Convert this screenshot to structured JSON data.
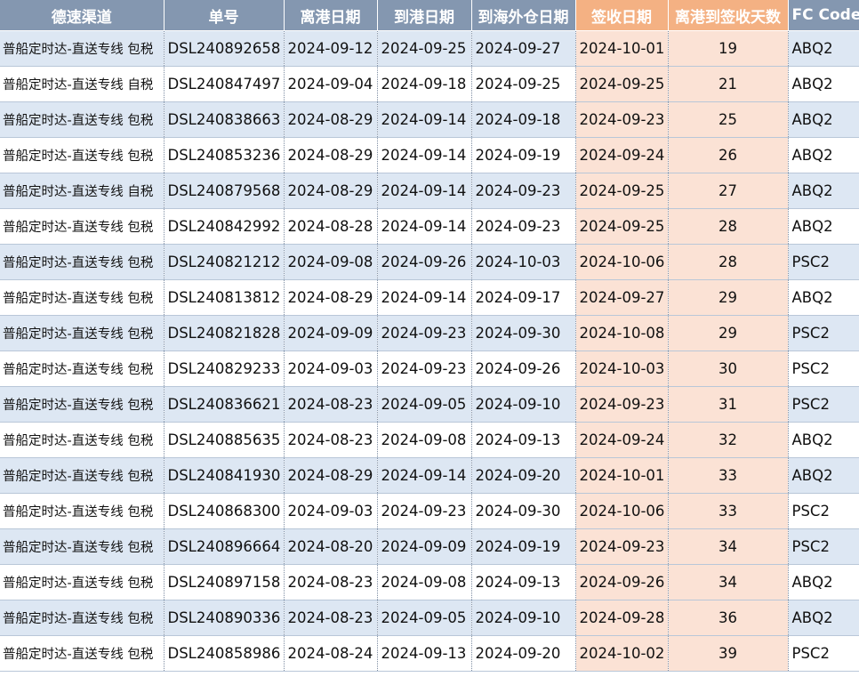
{
  "headers": [
    "德速渠道",
    "单号",
    "离港日期",
    "到港日期",
    "到海外仓日期",
    "签收日期",
    "离港到签收天数",
    "FC Code"
  ],
  "rows": [
    {
      "channel": "普船定时达-直送专线 包税",
      "order": "DSL240892658",
      "depart": "2024-09-12",
      "arrive": "2024-09-25",
      "warehouse": "2024-09-27",
      "signed": "2024-10-01",
      "days": "19",
      "fc": "ABQ2"
    },
    {
      "channel": "普船定时达-直送专线 自税",
      "order": "DSL240847497",
      "depart": "2024-09-04",
      "arrive": "2024-09-18",
      "warehouse": "2024-09-25",
      "signed": "2024-09-25",
      "days": "21",
      "fc": "ABQ2"
    },
    {
      "channel": "普船定时达-直送专线 包税",
      "order": "DSL240838663",
      "depart": "2024-08-29",
      "arrive": "2024-09-14",
      "warehouse": "2024-09-18",
      "signed": "2024-09-23",
      "days": "25",
      "fc": "ABQ2"
    },
    {
      "channel": "普船定时达-直送专线 包税",
      "order": "DSL240853236",
      "depart": "2024-08-29",
      "arrive": "2024-09-14",
      "warehouse": "2024-09-19",
      "signed": "2024-09-24",
      "days": "26",
      "fc": "ABQ2"
    },
    {
      "channel": "普船定时达-直送专线 自税",
      "order": "DSL240879568",
      "depart": "2024-08-29",
      "arrive": "2024-09-14",
      "warehouse": "2024-09-23",
      "signed": "2024-09-25",
      "days": "27",
      "fc": "ABQ2"
    },
    {
      "channel": "普船定时达-直送专线 包税",
      "order": "DSL240842992",
      "depart": "2024-08-28",
      "arrive": "2024-09-14",
      "warehouse": "2024-09-23",
      "signed": "2024-09-25",
      "days": "28",
      "fc": "ABQ2"
    },
    {
      "channel": "普船定时达-直送专线 包税",
      "order": "DSL240821212",
      "depart": "2024-09-08",
      "arrive": "2024-09-26",
      "warehouse": "2024-10-03",
      "signed": "2024-10-06",
      "days": "28",
      "fc": "PSC2"
    },
    {
      "channel": "普船定时达-直送专线 包税",
      "order": "DSL240813812",
      "depart": "2024-08-29",
      "arrive": "2024-09-14",
      "warehouse": "2024-09-17",
      "signed": "2024-09-27",
      "days": "29",
      "fc": "ABQ2"
    },
    {
      "channel": "普船定时达-直送专线 包税",
      "order": "DSL240821828",
      "depart": "2024-09-09",
      "arrive": "2024-09-23",
      "warehouse": "2024-09-30",
      "signed": "2024-10-08",
      "days": "29",
      "fc": "PSC2"
    },
    {
      "channel": "普船定时达-直送专线 包税",
      "order": "DSL240829233",
      "depart": "2024-09-03",
      "arrive": "2024-09-23",
      "warehouse": "2024-09-26",
      "signed": "2024-10-03",
      "days": "30",
      "fc": "PSC2"
    },
    {
      "channel": "普船定时达-直送专线 包税",
      "order": "DSL240836621",
      "depart": "2024-08-23",
      "arrive": "2024-09-05",
      "warehouse": "2024-09-10",
      "signed": "2024-09-23",
      "days": "31",
      "fc": "PSC2"
    },
    {
      "channel": "普船定时达-直送专线 包税",
      "order": "DSL240885635",
      "depart": "2024-08-23",
      "arrive": "2024-09-08",
      "warehouse": "2024-09-13",
      "signed": "2024-09-24",
      "days": "32",
      "fc": "ABQ2"
    },
    {
      "channel": "普船定时达-直送专线 包税",
      "order": "DSL240841930",
      "depart": "2024-08-29",
      "arrive": "2024-09-14",
      "warehouse": "2024-09-20",
      "signed": "2024-10-01",
      "days": "33",
      "fc": "ABQ2"
    },
    {
      "channel": "普船定时达-直送专线 包税",
      "order": "DSL240868300",
      "depart": "2024-09-03",
      "arrive": "2024-09-23",
      "warehouse": "2024-09-30",
      "signed": "2024-10-06",
      "days": "33",
      "fc": "PSC2"
    },
    {
      "channel": "普船定时达-直送专线 包税",
      "order": "DSL240896664",
      "depart": "2024-08-20",
      "arrive": "2024-09-09",
      "warehouse": "2024-09-19",
      "signed": "2024-09-23",
      "days": "34",
      "fc": "PSC2"
    },
    {
      "channel": "普船定时达-直送专线 包税",
      "order": "DSL240897158",
      "depart": "2024-08-23",
      "arrive": "2024-09-08",
      "warehouse": "2024-09-13",
      "signed": "2024-09-26",
      "days": "34",
      "fc": "ABQ2"
    },
    {
      "channel": "普船定时达-直送专线 包税",
      "order": "DSL240890336",
      "depart": "2024-08-23",
      "arrive": "2024-09-05",
      "warehouse": "2024-09-10",
      "signed": "2024-09-28",
      "days": "36",
      "fc": "ABQ2"
    },
    {
      "channel": "普船定时达-直送专线 包税",
      "order": "DSL240858986",
      "depart": "2024-08-24",
      "arrive": "2024-09-13",
      "warehouse": "2024-09-20",
      "signed": "2024-10-02",
      "days": "39",
      "fc": "PSC2"
    }
  ],
  "colors": {
    "header": "#8497b0",
    "header_highlight": "#f4b183",
    "row_stripe": "#dde7f3",
    "signed_highlight": "#fbe2d5"
  }
}
